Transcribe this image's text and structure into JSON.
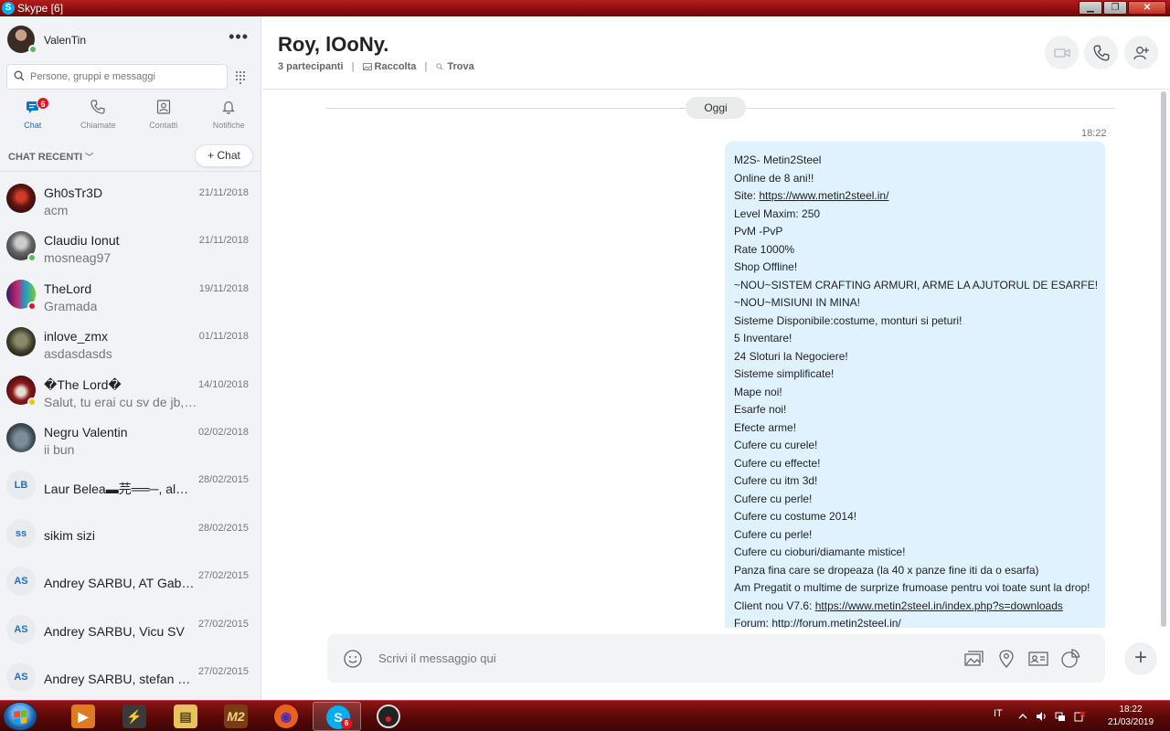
{
  "window": {
    "title": "Skype [6]",
    "app_icon": "S"
  },
  "sidebar": {
    "profile": {
      "name": "ValenTin",
      "more": "•••"
    },
    "search": {
      "placeholder": "Persone, gruppi e messaggi"
    },
    "tabs": [
      {
        "label": "Chat",
        "icon": "chat-icon",
        "badge": "6",
        "active": true
      },
      {
        "label": "Chiamate",
        "icon": "phone-icon"
      },
      {
        "label": "Contatti",
        "icon": "contacts-icon"
      },
      {
        "label": "Notifiche",
        "icon": "bell-icon"
      }
    ],
    "recent_label": "CHAT RECENTI",
    "new_chat_label": "+ Chat",
    "chats": [
      {
        "name": "Gh0sTr3D",
        "preview": "acm",
        "date": "21/11/2018"
      },
      {
        "name": "Claudiu Ionut",
        "preview": "mosneag97",
        "date": "21/11/2018"
      },
      {
        "name": "TheLord",
        "preview": "Gramada",
        "date": "19/11/2018"
      },
      {
        "name": "inlove_zmx",
        "preview": "asdasdasds",
        "date": "01/11/2018"
      },
      {
        "name": "�The Lord�",
        "preview": "Salut, tu erai cu sv de jb, pa...",
        "date": "14/10/2018"
      },
      {
        "name": "Negru Valentin",
        "preview": "ii bun",
        "date": "02/02/2018"
      },
      {
        "name": "Laur Belea▬芫══─, alec...",
        "preview": "",
        "date": "28/02/2015",
        "initials": "LB"
      },
      {
        "name": "sikim sizi",
        "preview": "",
        "date": "28/02/2015",
        "initials": "ss"
      },
      {
        "name": "Andrey SARBU, AT GabyR...",
        "preview": "",
        "date": "27/02/2015",
        "initials": "AS"
      },
      {
        "name": "Andrey SARBU, Vicu SV",
        "preview": "",
        "date": "27/02/2015",
        "initials": "AS"
      },
      {
        "name": "Andrey SARBU, stefan sc...",
        "preview": "",
        "date": "27/02/2015",
        "initials": "AS"
      }
    ]
  },
  "conversation": {
    "title": "Roy, lOoNy.",
    "participants": "3 partecipanti",
    "gallery": "Raccolta",
    "find": "Trova",
    "day_label": "Oggi",
    "time": "18:22",
    "message_lines": [
      "M2S- Metin2Steel",
      "Online de 8 ani!!",
      "Site: ",
      "Level Maxim: 250",
      "PvM -PvP",
      "Rate 1000%",
      "Shop Offline!",
      "~NOU~SISTEM CRAFTING ARMURI, ARME LA AJUTORUL DE ESARFE!",
      "~NOU~MISIUNI IN MINA!",
      "Sisteme Disponibile:costume, monturi si peturi!",
      "5 Inventare!",
      "24 Sloturi la Negociere!",
      "Sisteme simplificate!",
      "Mape noi!",
      "Esarfe noi!",
      "Efecte arme!",
      "Cufere cu curele!",
      "Cufere cu effecte!",
      "Cufere cu itm 3d!",
      "Cufere cu perle!",
      "Cufere cu costume 2014!",
      "Cufere cu perle!",
      "Cufere cu cioburi/diamante mistice!",
      "Panza fina care se dropeaza (la 40 x panze fine iti da o esarfa)",
      "Am Pregatit o multime de surprize frumoase pentru voi toate sunt la drop!",
      "Client nou V7.6: ",
      "Forum: http://forum.metin2steel.in/"
    ],
    "site_link": "https://www.metin2steel.in/",
    "client_link": "https://www.metin2steel.in/index.php?s=downloads",
    "composer_placeholder": "Scrivi il messaggio qui"
  },
  "taskbar": {
    "apps": [
      {
        "name": "media-player",
        "glyph": "▶",
        "color": "#e07a1f"
      },
      {
        "name": "winamp",
        "glyph": "⚡",
        "color": "#3a3a3a"
      },
      {
        "name": "explorer",
        "glyph": "▤",
        "color": "#e8c25a"
      },
      {
        "name": "metin2",
        "glyph": "M2",
        "color": "#7a3b12"
      },
      {
        "name": "firefox",
        "glyph": "◉",
        "color": "#e8621e"
      },
      {
        "name": "skype",
        "glyph": "S",
        "color": "#00aff0",
        "badge": "6"
      },
      {
        "name": "recorder",
        "glyph": "●",
        "color": "#222"
      }
    ],
    "language": "IT",
    "time": "18:22",
    "date": "21/03/2019"
  },
  "colors": {
    "accent": "#0078d4",
    "bubble": "#dff2fd",
    "badge": "#e81123",
    "online": "#5cb85c"
  }
}
